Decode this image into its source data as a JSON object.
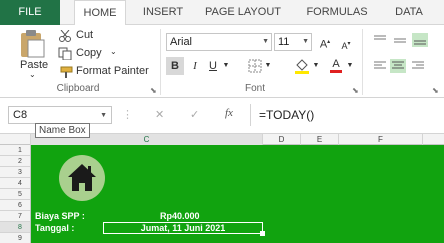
{
  "ribbon_tabs": [
    "FILE",
    "HOME",
    "INSERT",
    "PAGE LAYOUT",
    "FORMULAS",
    "DATA"
  ],
  "clipboard": {
    "paste": "Paste",
    "cut": "Cut",
    "copy": "Copy",
    "format_painter": "Format Painter",
    "group_label": "Clipboard"
  },
  "font": {
    "family": "Arial",
    "size": "11",
    "group_label": "Font",
    "bold": "B",
    "italic": "I",
    "underline": "U",
    "grow": "A",
    "shrink": "A",
    "color_a": "A"
  },
  "formula_bar": {
    "name_box": "C8",
    "formula": "=TODAY()",
    "cancel": "✕",
    "enter": "✓",
    "fx": "fx"
  },
  "tooltip": "Name Box",
  "columns": [
    "C",
    "D",
    "E",
    "F"
  ],
  "rows": [
    "1",
    "2",
    "3",
    "4",
    "5",
    "6",
    "7",
    "8",
    "9"
  ],
  "cells": {
    "b7_label": "Biaya SPP :",
    "c7_value": "Rp40.000",
    "b8_label": "Tanggal :",
    "c8_value": "Jumat, 11 Juni 2021"
  },
  "colors": {
    "sheet_bg": "#11a30f",
    "file_tab": "#217346",
    "home_circle": "#a9d08e"
  }
}
